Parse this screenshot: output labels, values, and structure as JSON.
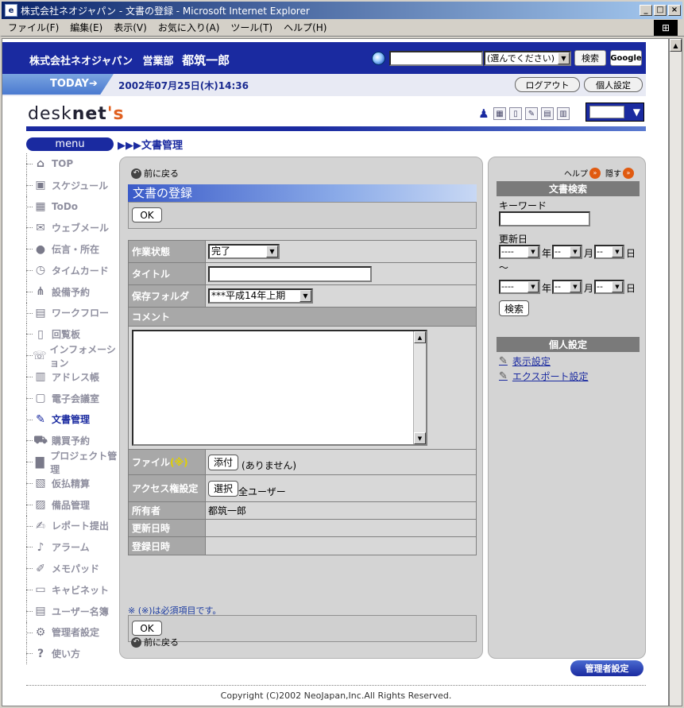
{
  "window": {
    "title": "株式会社ネオジャパン - 文書の登録 - Microsoft Internet Explorer",
    "minimize": "_",
    "maximize": "□",
    "close": "×"
  },
  "menubar": [
    "ファイル(F)",
    "編集(E)",
    "表示(V)",
    "お気に入り(A)",
    "ツール(T)",
    "ヘルプ(H)"
  ],
  "header": {
    "company": "株式会社ネオジャパン",
    "dept": "営業部",
    "user": "都筑一郎",
    "scope": "(選んでください)",
    "search_label": "検索",
    "google_label": "Google"
  },
  "todaybar": {
    "today_label": "TODAY➔",
    "datetime": "2002年07月25日(木)14:36",
    "logout": "ログアウト",
    "personal": "個人設定"
  },
  "logo": {
    "part1": "desk",
    "part2": "net",
    "part3": "'s"
  },
  "menu_label": "menu",
  "breadcrumb": "▶▶▶文書管理",
  "nav": [
    {
      "label": "TOP",
      "icon": "⌂"
    },
    {
      "label": "スケジュール",
      "icon": "▣"
    },
    {
      "label": "ToDo",
      "icon": "▦"
    },
    {
      "label": "ウェブメール",
      "icon": "✉"
    },
    {
      "label": "伝言・所在",
      "icon": "●"
    },
    {
      "label": "タイムカード",
      "icon": "◷"
    },
    {
      "label": "設備予約",
      "icon": "⋔"
    },
    {
      "label": "ワークフロー",
      "icon": "▤"
    },
    {
      "label": "回覧板",
      "icon": "▯"
    },
    {
      "label": "インフォメーション",
      "icon": "☏"
    },
    {
      "label": "アドレス帳",
      "icon": "▥"
    },
    {
      "label": "電子会議室",
      "icon": "▢"
    },
    {
      "label": "文書管理",
      "icon": "✎",
      "active": true
    },
    {
      "label": "購買予約",
      "icon": "⛟"
    },
    {
      "label": "プロジェクト管理",
      "icon": "▇"
    },
    {
      "label": "仮払精算",
      "icon": "▧"
    },
    {
      "label": "備品管理",
      "icon": "▨"
    },
    {
      "label": "レポート提出",
      "icon": "✍"
    },
    {
      "label": "アラーム",
      "icon": "♪"
    },
    {
      "label": "メモパッド",
      "icon": "✐"
    },
    {
      "label": "キャビネット",
      "icon": "▭"
    },
    {
      "label": "ユーザー名簿",
      "icon": "▤"
    },
    {
      "label": "管理者設定",
      "icon": "⚙"
    },
    {
      "label": "使い方",
      "icon": "?"
    }
  ],
  "main": {
    "back": "前に戻る",
    "title": "文書の登録",
    "ok": "OK",
    "rows": {
      "status_label": "作業状態",
      "status_value": "完了",
      "title_label": "タイトル",
      "folder_label": "保存フォルダ",
      "folder_value": "***平成14年上期",
      "comment_label": "コメント",
      "file_label": "ファイル",
      "file_req": "(※)",
      "attach_btn": "添付",
      "file_value": "(ありません)",
      "access_label": "アクセス権設定",
      "select_btn": "選択",
      "access_value": "全ユーザー",
      "owner_label": "所有者",
      "owner_value": "都筑一郎",
      "updated_label": "更新日時",
      "registered_label": "登録日時"
    },
    "note": "※ (※)は必須項目です。"
  },
  "right": {
    "help": "ヘルプ",
    "hide": "隠す",
    "search_title": "文書検索",
    "keyword": "キーワード",
    "updated": "更新日",
    "range": "～",
    "dash_year": "----",
    "dash_md": "--",
    "year": "年",
    "month": "月",
    "day": "日",
    "search_btn": "検索",
    "personal_title": "個人設定",
    "display_settings": "表示設定",
    "export_settings": "エクスポート設定"
  },
  "admin_button": "管理者設定",
  "copyright": "Copyright (C)2002 NeoJapan,Inc.All Rights Reserved."
}
